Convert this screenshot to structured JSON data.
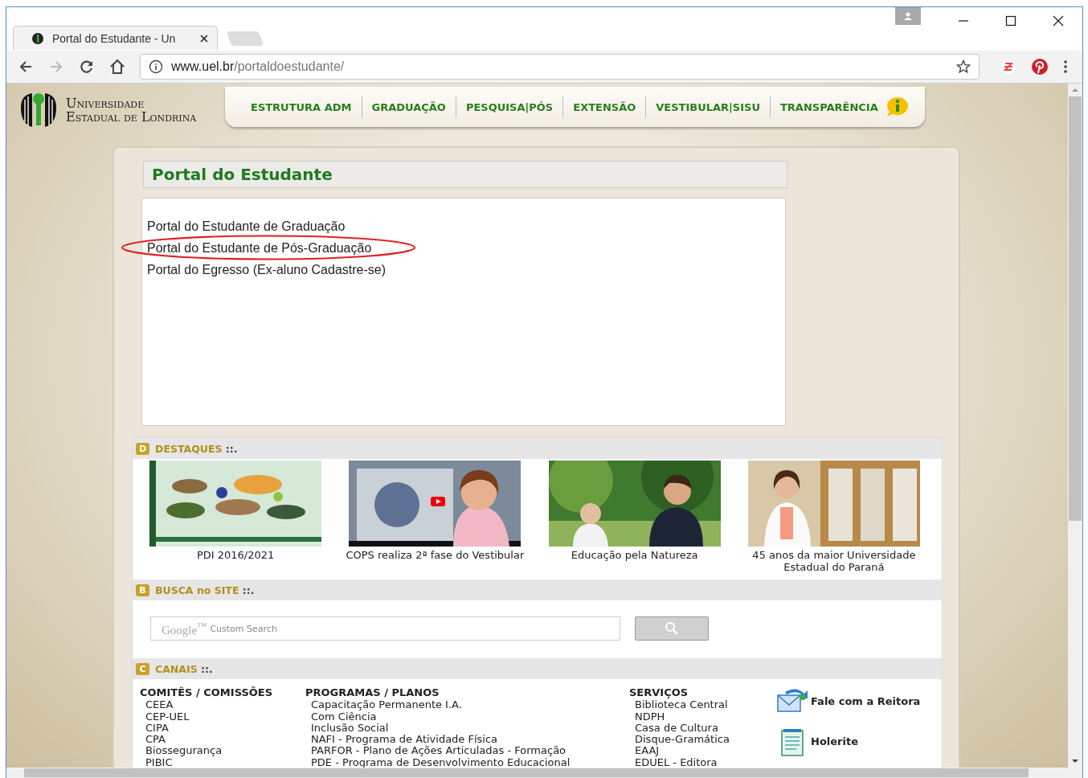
{
  "browser": {
    "tab_title": "Portal do Estudante - Un",
    "url_host": "www.uel.br",
    "url_path": "/portaldoestudante/"
  },
  "logo": {
    "line_1": "Universidade",
    "line_2": "Estadual de Londrina"
  },
  "nav": [
    {
      "label": "ESTRUTURA ADM"
    },
    {
      "label": "GRADUAÇÃO"
    },
    {
      "label": "PESQUISA|PÓS"
    },
    {
      "label": "EXTENSÃO"
    },
    {
      "label": "VESTIBULAR|SISU"
    },
    {
      "label": "TRANSPARÊNCIA"
    }
  ],
  "portal": {
    "title": "Portal do Estudante",
    "links": [
      {
        "label": "Portal do Estudante de Graduação",
        "highlighted": false
      },
      {
        "label": "Portal do Estudante de Pós-Graduação",
        "highlighted": true
      },
      {
        "label": "Portal do Egresso (Ex-aluno Cadastre-se)",
        "highlighted": false
      }
    ]
  },
  "destaques": {
    "badge": "D",
    "title": "DESTAQUES",
    "suffix": "::.",
    "items": [
      {
        "caption": "PDI 2016/2021",
        "kind": "poster"
      },
      {
        "caption": "COPS realiza 2ª fase do Vestibular",
        "kind": "video"
      },
      {
        "caption": "Educação pela Natureza",
        "kind": "outdoor"
      },
      {
        "caption": "45 anos da maior Universidade Estadual do Paraná",
        "kind": "interior"
      }
    ]
  },
  "busca": {
    "badge": "B",
    "title": "BUSCA no SITE",
    "suffix": "::.",
    "brand": "Google$^{™}$",
    "placeholder": "Custom Search"
  },
  "canais": {
    "badge": "C",
    "title": "CANAIS",
    "suffix": "::.",
    "columns": [
      {
        "heading": "COMITÊS / COMISSÕES",
        "items": [
          "CEEA",
          "CEP-UEL",
          "CIPA",
          "CPA",
          "Biossegurança",
          "PIBIC"
        ]
      },
      {
        "heading": "PROGRAMAS / PLANOS",
        "items": [
          "Capacitação Permanente I.A.",
          "Com Ciência",
          "Inclusão Social",
          "NAFI - Programa de Atividade Física",
          "PARFOR - Plano de Ações Articuladas - Formação",
          "PDE - Programa de Desenvolvimento Educacional"
        ]
      },
      {
        "heading": "SERVIÇOS",
        "items": [
          "Biblioteca Central",
          "NDPH",
          "Casa de Cultura",
          "Disque-Gramática",
          "EAAJ",
          "EDUEL - Editora"
        ]
      }
    ],
    "links": [
      {
        "label": "Fale com a Reitora",
        "kind": "mail"
      },
      {
        "label": "Holerite",
        "kind": "document"
      }
    ]
  }
}
